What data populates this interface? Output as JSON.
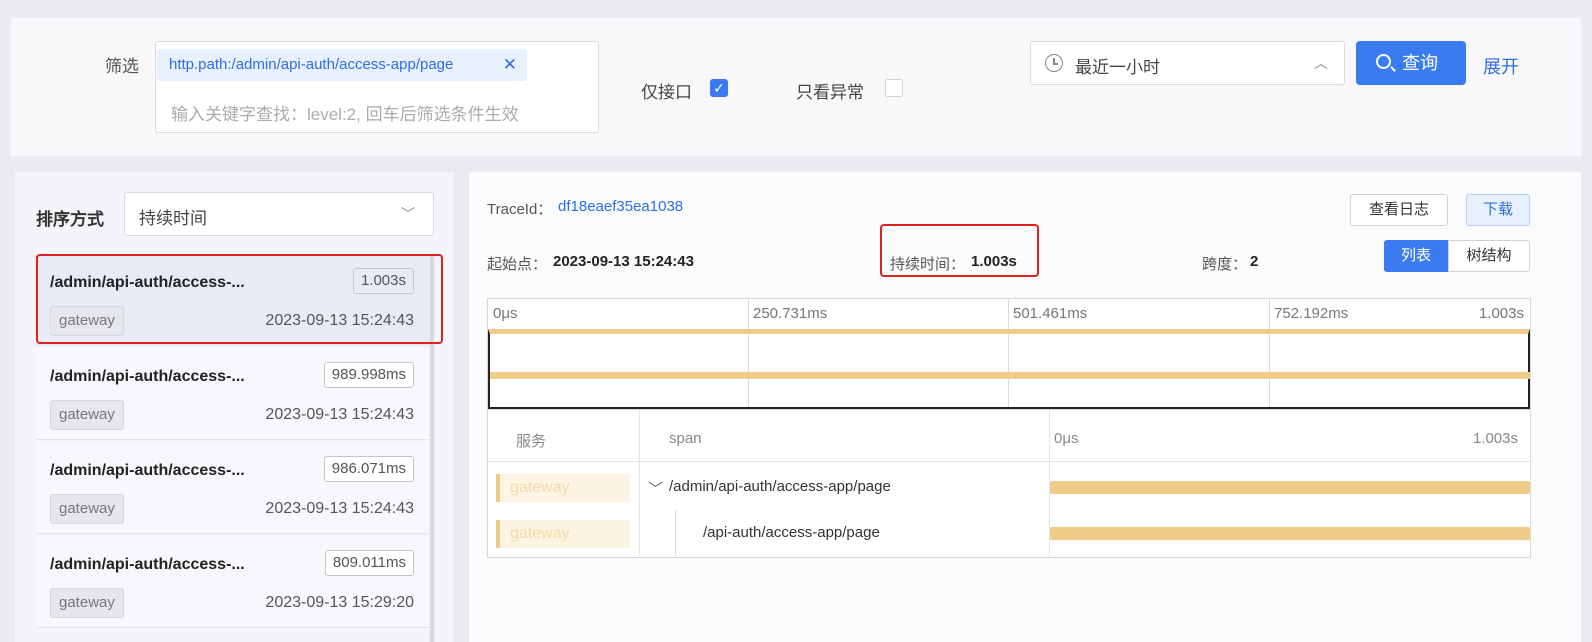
{
  "filter": {
    "label": "筛选",
    "tag": "http.path:/admin/api-auth/access-app/page",
    "tag_remove_icon": "close-icon",
    "placeholder": "输入关键字查找：level:2, 回车后筛选条件生效"
  },
  "options": {
    "api_only_label": "仅接口",
    "api_only_checked": true,
    "errors_only_label": "只看异常",
    "errors_only_checked": false
  },
  "time_range": {
    "icon": "clock-icon",
    "value": "最近一小时",
    "chevron": "chevron-up-icon"
  },
  "query_button": {
    "icon": "search-icon",
    "label": "查询"
  },
  "expand_link": "展开",
  "sort": {
    "label": "排序方式",
    "value": "持续时间"
  },
  "traces": [
    {
      "path": "/admin/api-auth/access-...",
      "duration": "1.003s",
      "service": "gateway",
      "time": "2023-09-13 15:24:43",
      "selected": true
    },
    {
      "path": "/admin/api-auth/access-...",
      "duration": "989.998ms",
      "service": "gateway",
      "time": "2023-09-13 15:24:43",
      "selected": false
    },
    {
      "path": "/admin/api-auth/access-...",
      "duration": "986.071ms",
      "service": "gateway",
      "time": "2023-09-13 15:24:43",
      "selected": false
    },
    {
      "path": "/admin/api-auth/access-...",
      "duration": "809.011ms",
      "service": "gateway",
      "time": "2023-09-13 15:29:20",
      "selected": false
    }
  ],
  "detail": {
    "trace_id_label": "TraceId：",
    "trace_id": "df18eaef35ea1038",
    "view_logs_label": "查看日志",
    "download_label": "下载",
    "start_label": "起始点：",
    "start_value": "2023-09-13 15:24:43",
    "duration_label": "持续时间：",
    "duration_value": "1.003s",
    "depth_label": "跨度：",
    "depth_value": "2",
    "view_list_label": "列表",
    "view_tree_label": "树结构"
  },
  "overview": {
    "ticks": [
      "0μs",
      "250.731ms",
      "501.461ms",
      "752.192ms",
      "1.003s"
    ]
  },
  "span_table": {
    "headers": {
      "service": "服务",
      "span": "span",
      "start": "0μs",
      "end": "1.003s"
    },
    "rows": [
      {
        "service": "gateway",
        "name": "/admin/api-auth/access-app/page",
        "expand_icon": "chevron-down-icon",
        "level": 0,
        "fraction": 1.0
      },
      {
        "service": "gateway",
        "name": "/api-auth/access-app/page",
        "level": 1,
        "fraction": 1.0
      }
    ]
  },
  "colors": {
    "primary": "#3a7bf0",
    "link": "#2f6ee0",
    "span_bar": "#f0cc8a",
    "highlight": "#e02020"
  }
}
